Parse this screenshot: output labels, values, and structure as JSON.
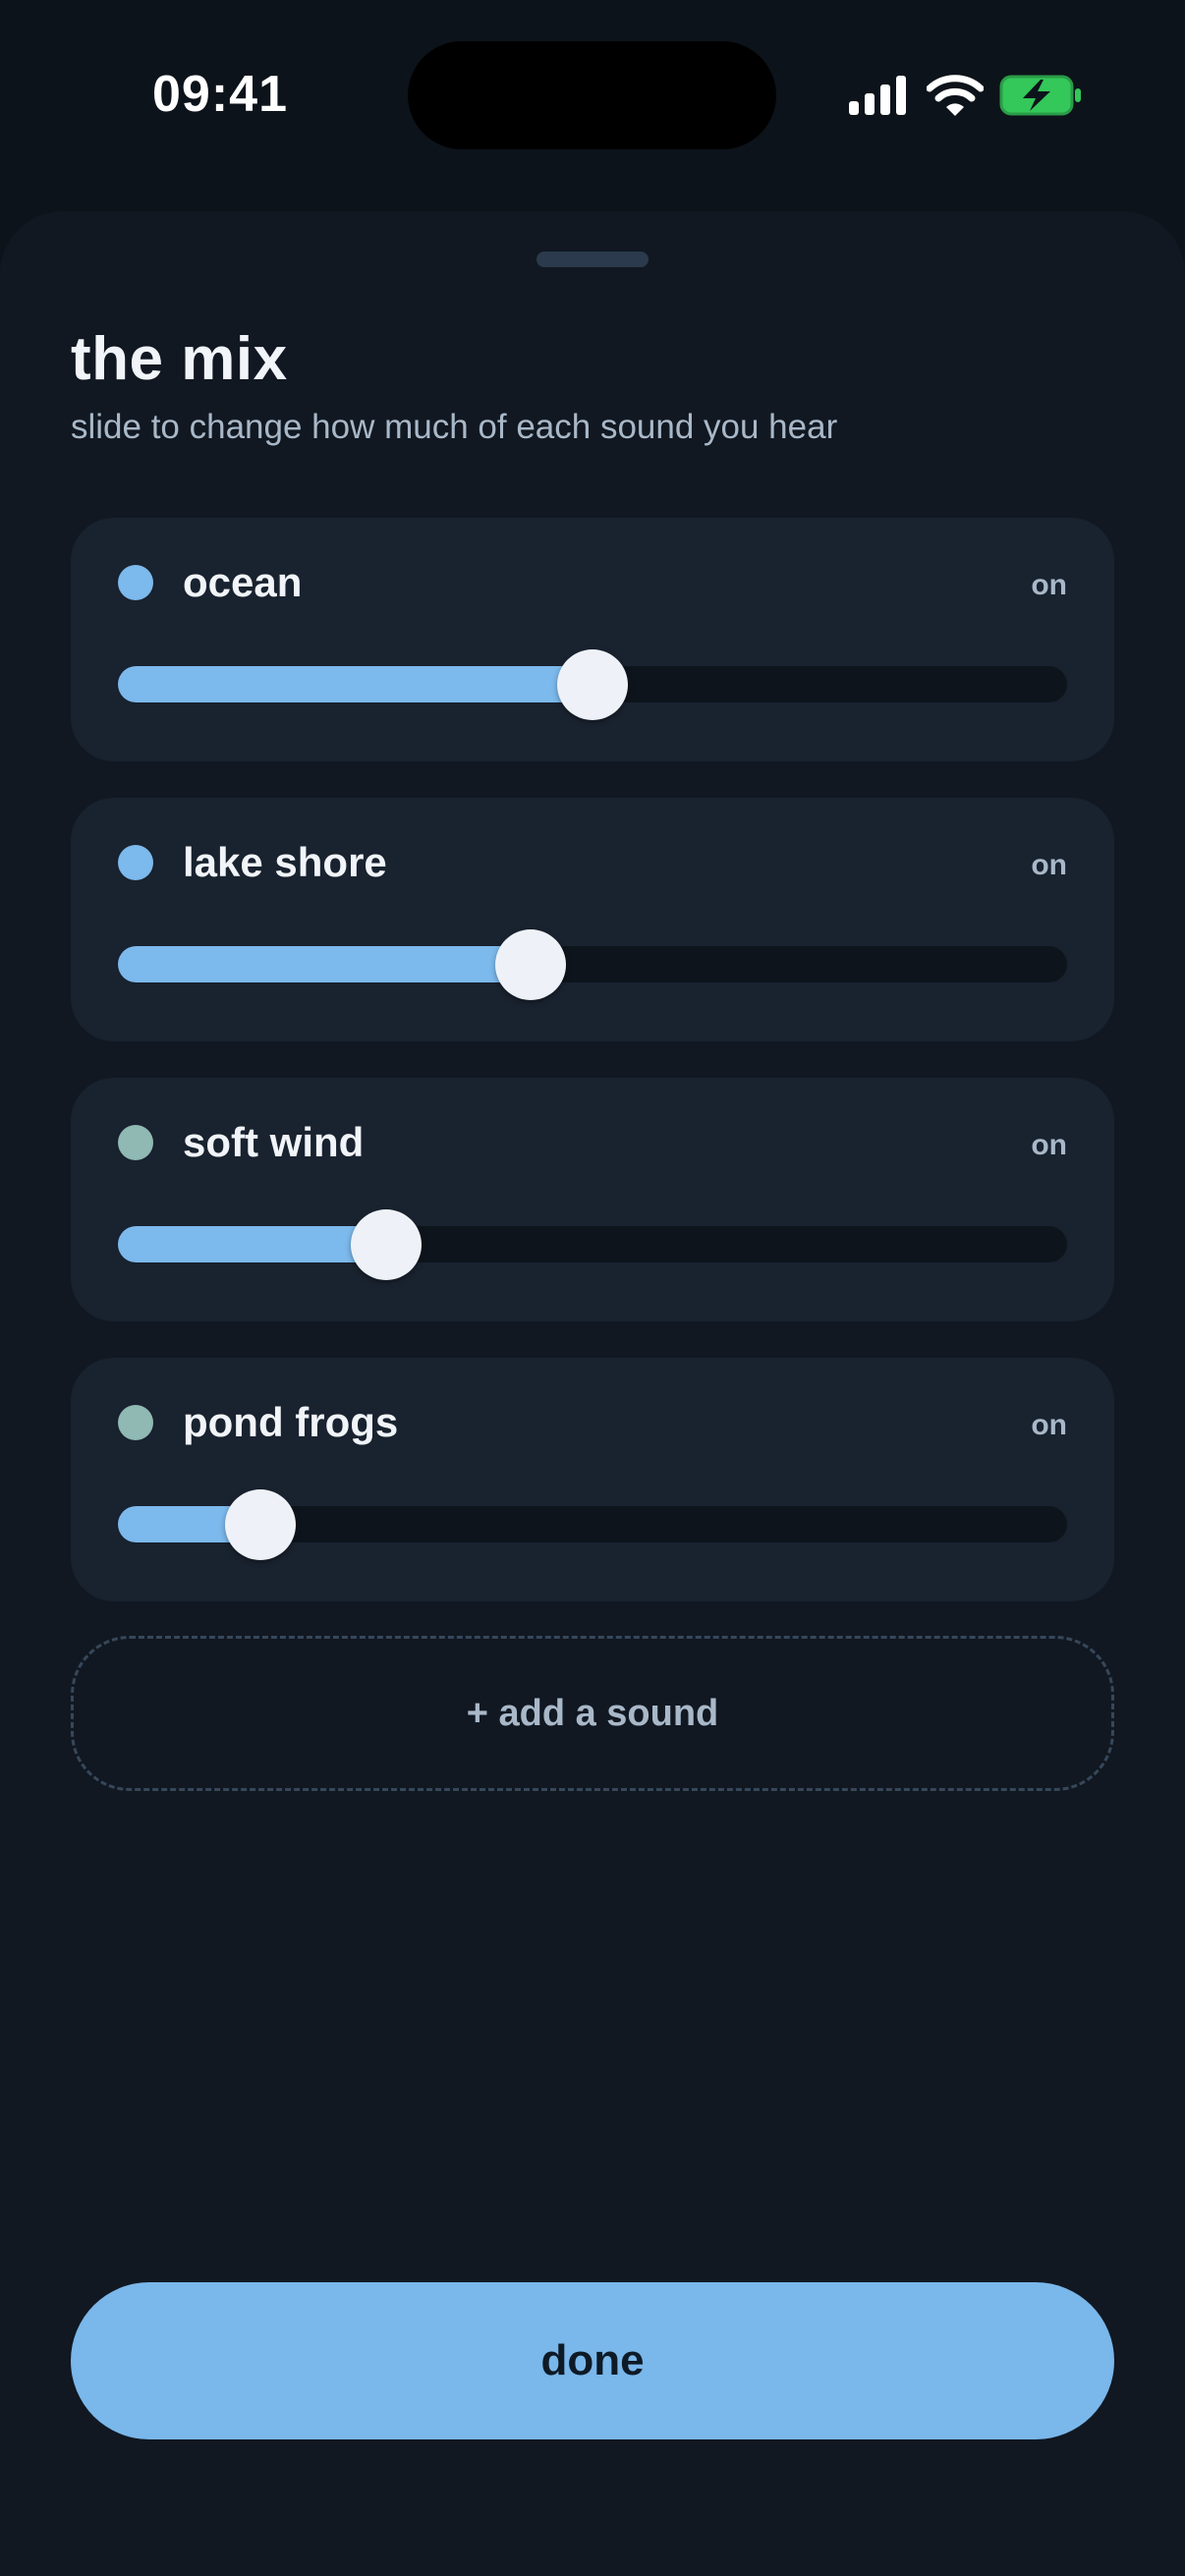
{
  "status_bar": {
    "time": "09:41",
    "icons": [
      "cellular-signal-icon",
      "wifi-icon",
      "battery-charging-icon"
    ],
    "battery_color": "#34c759"
  },
  "sheet": {
    "title": "the mix",
    "subtitle": "slide to change how much of each sound you hear",
    "sounds": [
      {
        "name": "ocean",
        "state": "on",
        "level": 0.5,
        "dot_color": "#7cb9ec"
      },
      {
        "name": "lake shore",
        "state": "on",
        "level": 0.435,
        "dot_color": "#7cb9ec"
      },
      {
        "name": "soft wind",
        "state": "on",
        "level": 0.283,
        "dot_color": "#8fb9b2"
      },
      {
        "name": "pond frogs",
        "state": "on",
        "level": 0.15,
        "dot_color": "#8fb9b2"
      }
    ],
    "add_sound_label": "+ add a sound",
    "done_label": "done"
  },
  "colors": {
    "accent": "#7ab7ea",
    "background": "#111822",
    "card": "#19222f"
  }
}
